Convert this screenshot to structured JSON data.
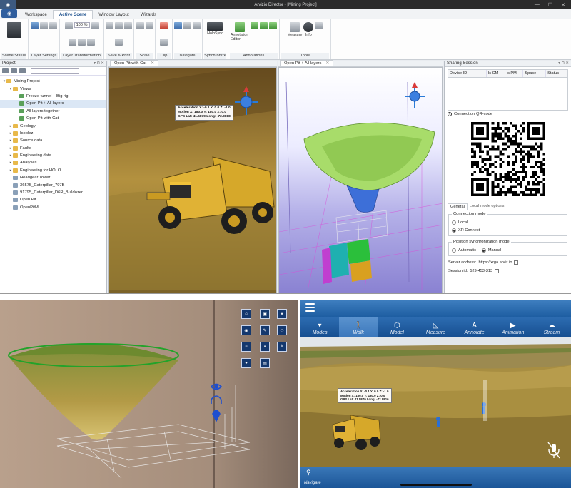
{
  "window": {
    "title": "Arvizio Director - [Mining Project]",
    "controls": [
      "—",
      "☐",
      "✕"
    ]
  },
  "menu_tabs": [
    "Workspace",
    "Active Scene",
    "Window Layout",
    "Wizards"
  ],
  "active_menu_tab": "Active Scene",
  "ribbon": {
    "zoom_value": "100 %",
    "groups": [
      "Scene Status",
      "Layer Settings",
      "Layer Transformation",
      "Save & Print",
      "Scale",
      "Clip",
      "Navigate",
      "Synchronize",
      "Annotations",
      "Tools"
    ],
    "holosync_label": "HoloSync",
    "annotation_editor_label": "Annotation Editor",
    "measure_label": "Measure",
    "info_label": "Info"
  },
  "project_panel": {
    "title": "Project",
    "tree": [
      {
        "label": "Mining Project",
        "level": 0,
        "icon": "folder",
        "toggle": "▾"
      },
      {
        "label": "Views",
        "level": 1,
        "icon": "folder",
        "toggle": "▾"
      },
      {
        "label": "Freeze tunnel + Big rig",
        "level": 2,
        "icon": "view",
        "toggle": ""
      },
      {
        "label": "Open Pit + All layers",
        "level": 2,
        "icon": "view",
        "toggle": "",
        "selected": true
      },
      {
        "label": "All layers together",
        "level": 2,
        "icon": "view",
        "toggle": ""
      },
      {
        "label": "Open Pit with Cat",
        "level": 2,
        "icon": "view",
        "toggle": ""
      },
      {
        "label": "Geology",
        "level": 1,
        "icon": "folder",
        "toggle": "▸"
      },
      {
        "label": "Isoplez",
        "level": 1,
        "icon": "folder",
        "toggle": "▸"
      },
      {
        "label": "Source data",
        "level": 1,
        "icon": "folder",
        "toggle": "▸"
      },
      {
        "label": "Faults",
        "level": 1,
        "icon": "folder",
        "toggle": "▸"
      },
      {
        "label": "Engineering data",
        "level": 1,
        "icon": "folder",
        "toggle": "▸"
      },
      {
        "label": "Analyses",
        "level": 1,
        "icon": "folder",
        "toggle": "▸"
      },
      {
        "label": "Engineering for HOLO",
        "level": 1,
        "icon": "folder",
        "toggle": "▸"
      },
      {
        "label": "Headgear Tower",
        "level": 1,
        "icon": "obj",
        "toggle": ""
      },
      {
        "label": "36575_Caterpillar_797B",
        "level": 1,
        "icon": "obj",
        "toggle": ""
      },
      {
        "label": "91795_Caterpillar_D6R_Bulldozer",
        "level": 1,
        "icon": "obj",
        "toggle": ""
      },
      {
        "label": "Open Pit",
        "level": 1,
        "icon": "obj",
        "toggle": ""
      },
      {
        "label": "OpenPitM",
        "level": 1,
        "icon": "obj",
        "toggle": ""
      }
    ]
  },
  "view1": {
    "tab": "Open Pit with Cat",
    "telemetry": [
      "Acceleration  X: -0.1  Y: 0.0  Z: -1.0",
      "Motion  X: 180.0  Y: 180.0  Z: 0.0",
      "GPS  Lat: 41.5879  Long: -72.8818"
    ]
  },
  "view2": {
    "tab": "Open Pit + All layers"
  },
  "sharing": {
    "title": "Sharing Session",
    "columns": [
      "Device ID",
      "Is CM",
      "Is PM",
      "Space",
      "Status"
    ],
    "qr_title": "Connection QR-code",
    "tabs": [
      "General",
      "Local mode options"
    ],
    "connection_mode_label": "Connection mode",
    "connection_modes": [
      "Local",
      "XR Connect"
    ],
    "connection_selected": "XR Connect",
    "sync_mode_label": "Position synchronization mode",
    "sync_modes": [
      "Automatic",
      "Manual"
    ],
    "sync_selected": "Manual",
    "server_label": "Server address:",
    "server_value": "https://xrga.arviz.io",
    "session_label": "Session id:",
    "session_value": "529-453-313"
  },
  "holo": {
    "menu_icons": [
      "home-icon",
      "image-icon",
      "pin-icon",
      "eye-icon",
      "pencil-icon",
      "cube-icon",
      "layers-icon",
      "lock-icon",
      "grid-icon",
      "user-icon",
      "save-icon"
    ]
  },
  "tablet": {
    "nav": [
      {
        "label": "Modes",
        "icon": "▾"
      },
      {
        "label": "Walk",
        "icon": "🚶"
      },
      {
        "label": "Model",
        "icon": "⬡"
      },
      {
        "label": "Measure",
        "icon": "◺"
      },
      {
        "label": "Annotate",
        "icon": "A"
      },
      {
        "label": "Animation",
        "icon": "▶"
      },
      {
        "label": "Stream",
        "icon": "☁"
      }
    ],
    "active_nav": "Walk",
    "telemetry": [
      "Acceleration  X: -0.1  Y: 0.0  Z: -1.0",
      "Motion  X: 180.0  Y: 180.0  Z: 0.0",
      "GPS  Lat: 41.5879  Long: -72.8816"
    ],
    "bottom_label": "Navigate"
  }
}
